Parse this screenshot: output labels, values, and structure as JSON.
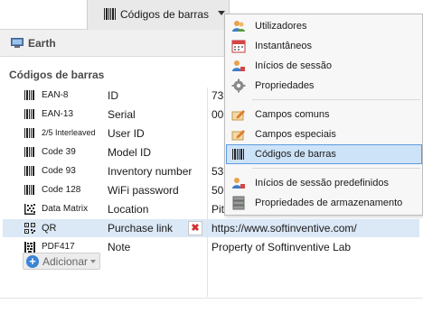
{
  "toolbar": {
    "tab_label": "Códigos de barras",
    "tab_icon": "barcode-icon"
  },
  "left_panel": {
    "header_label": "Earth",
    "header_icon": "computer-icon",
    "section_title": "Códigos de barras"
  },
  "barcodes": [
    {
      "type": "EAN-8",
      "name": "ID",
      "value": "73",
      "icon": "barcode-icon"
    },
    {
      "type": "EAN-13",
      "name": "Serial",
      "value": "00",
      "icon": "barcode-icon"
    },
    {
      "type": "2/5 Interleaved",
      "name": "User ID",
      "value": "",
      "icon": "barcode-icon"
    },
    {
      "type": "Code 39",
      "name": "Model ID",
      "value": "",
      "icon": "barcode-icon"
    },
    {
      "type": "Code 93",
      "name": "Inventory number",
      "value": "53",
      "icon": "barcode-icon"
    },
    {
      "type": "Code 128",
      "name": "WiFi password",
      "value": "50",
      "icon": "barcode-icon"
    },
    {
      "type": "Data Matrix",
      "name": "Location",
      "value": "Pit",
      "icon": "datamatrix-icon"
    },
    {
      "type": "QR",
      "name": "Purchase link",
      "value": "https://www.softinventive.com/",
      "icon": "qr-icon"
    },
    {
      "type": "PDF417",
      "name": "Note",
      "value": "Property of Softinventive Lab",
      "icon": "pdf417-icon"
    }
  ],
  "selected_row": 7,
  "delete_symbol": "✖",
  "add_button": {
    "label": "Adicionar",
    "symbol": "+"
  },
  "menu": {
    "items": [
      {
        "label": "Utilizadores",
        "icon": "users-icon"
      },
      {
        "label": "Instantâneos",
        "icon": "calendar-icon"
      },
      {
        "label": "Inícios de sessão",
        "icon": "user-login-icon"
      },
      {
        "label": "Propriedades",
        "icon": "gear-icon"
      },
      {
        "label": "Campos comuns",
        "icon": "edit-fields-icon"
      },
      {
        "label": "Campos especiais",
        "icon": "edit-fields-icon"
      },
      {
        "label": "Códigos de barras",
        "icon": "barcode-icon"
      },
      {
        "label": "Inícios de sessão predefinidos",
        "icon": "user-login-icon"
      },
      {
        "label": "Propriedades de armazenamento",
        "icon": "storage-icon"
      }
    ],
    "active_index": 6
  },
  "colors": {
    "selection": "#dbe8f6",
    "menu_highlight": "#cde3f8",
    "menu_highlight_border": "#5d9be0",
    "delete": "#d03030",
    "add": "#3a84d6"
  }
}
